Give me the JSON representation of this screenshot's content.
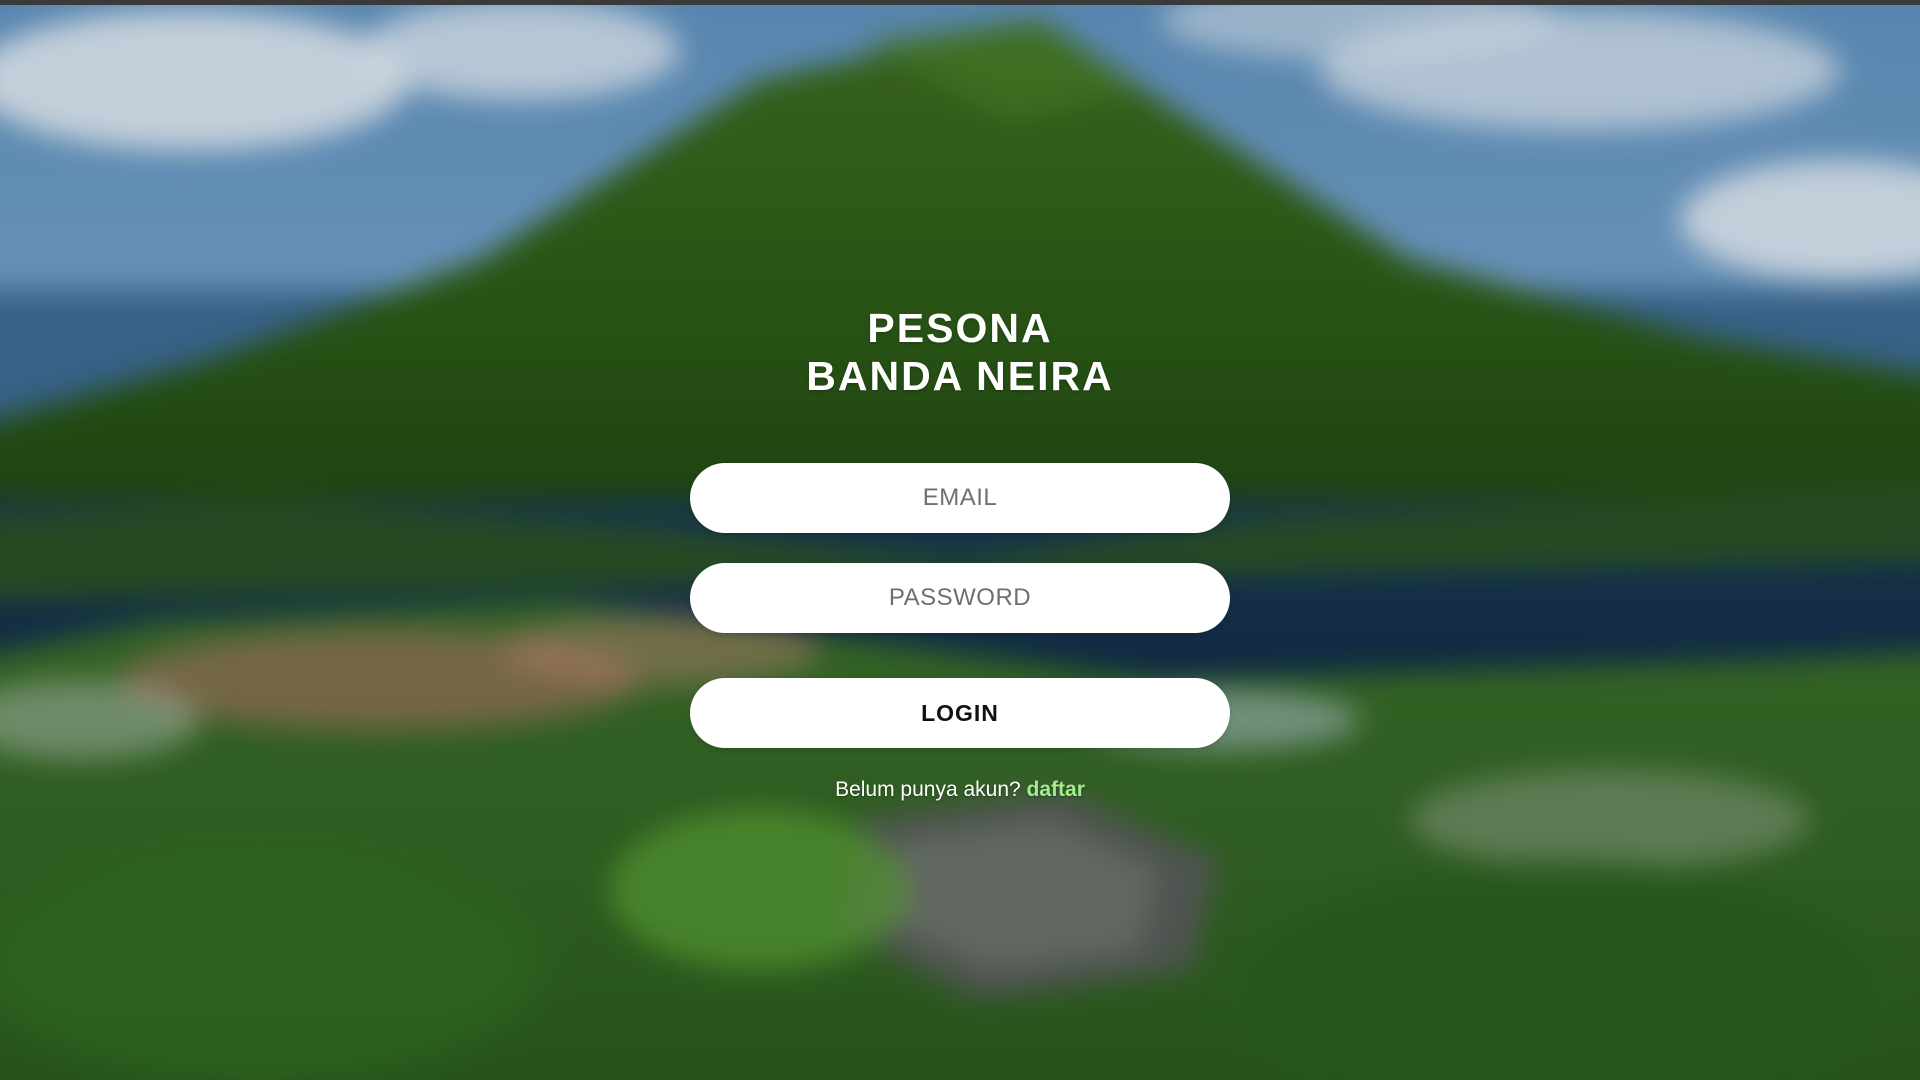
{
  "app": {
    "title_line1": "PESONA",
    "title_line2": "BANDA NEIRA"
  },
  "form": {
    "email_placeholder": "EMAIL",
    "email_value": "",
    "password_placeholder": "PASSWORD",
    "password_value": "",
    "login_label": "LOGIN"
  },
  "signup": {
    "prompt": "Belum punya akun?",
    "link_label": "daftar"
  },
  "background": {
    "description_icon": "mountain-island-photo"
  },
  "colors": {
    "link": "#9ff08a",
    "button_bg": "#ffffff",
    "title_text": "#ffffff"
  }
}
